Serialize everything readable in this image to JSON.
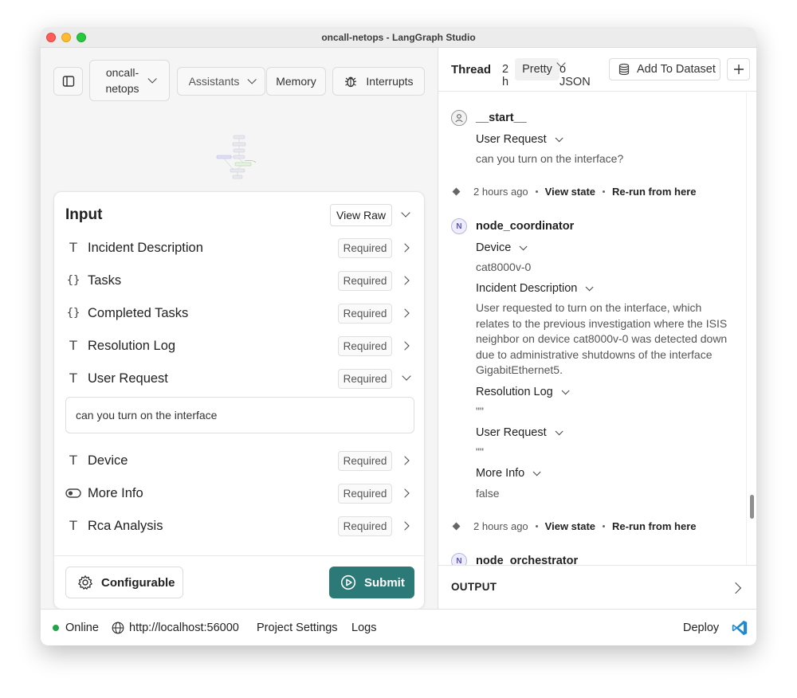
{
  "window": {
    "title": "oncall-netops - LangGraph Studio"
  },
  "toolbar": {
    "graph_select": "oncall-\nnetops",
    "graph_select_line1": "oncall-",
    "graph_select_line2": "netops",
    "assistants": "Assistants",
    "memory": "Memory",
    "interrupts": "Interrupts"
  },
  "input_panel": {
    "title": "Input",
    "view_raw": "View Raw",
    "required_label": "Required",
    "fields": [
      {
        "label": "Incident Description",
        "type": "text"
      },
      {
        "label": "Tasks",
        "type": "object"
      },
      {
        "label": "Completed Tasks",
        "type": "object"
      },
      {
        "label": "Resolution Log",
        "type": "text"
      },
      {
        "label": "User Request",
        "type": "text",
        "expanded": true
      },
      {
        "label": "Device",
        "type": "text"
      },
      {
        "label": "More Info",
        "type": "boolean"
      },
      {
        "label": "Rca Analysis",
        "type": "text"
      }
    ],
    "user_request_value": "can you turn on the interface",
    "configurable": "Configurable",
    "submit": "Submit"
  },
  "thread_panel": {
    "tab": "Thread",
    "hidden_text": "2 h",
    "pretty": "Pretty",
    "json_partial": "o JSON",
    "add_to_dataset": "Add To Dataset",
    "events": [
      {
        "node": "__start__",
        "kind": "person",
        "fields": [
          {
            "key": "User Request",
            "value": "can you turn on the interface?"
          }
        ],
        "time": "2 hours ago"
      },
      {
        "node": "node_coordinator",
        "kind": "node",
        "avatar": "N",
        "fields": [
          {
            "key": "Device",
            "value": "cat8000v-0"
          },
          {
            "key": "Incident Description",
            "value": "User requested to turn on the interface, which relates to the previous investigation where the ISIS neighbor on device cat8000v-0 was detected down due to administrative shutdowns of the interface GigabitEthernet5."
          },
          {
            "key": "Resolution Log",
            "value": "\"\""
          },
          {
            "key": "User Request",
            "value": "\"\""
          },
          {
            "key": "More Info",
            "value": "false"
          }
        ],
        "time": "2 hours ago"
      },
      {
        "node": "node_orchestrator",
        "kind": "node",
        "avatar": "N"
      }
    ],
    "view_state": "View state",
    "rerun": "Re-run from here",
    "output": "OUTPUT"
  },
  "statusbar": {
    "status": "Online",
    "url": "http://localhost:56000",
    "project_settings": "Project Settings",
    "logs": "Logs",
    "deploy": "Deploy"
  },
  "colors": {
    "accent": "#2b7a78",
    "online": "#22a447",
    "node_avatar": "#5b55c7"
  }
}
